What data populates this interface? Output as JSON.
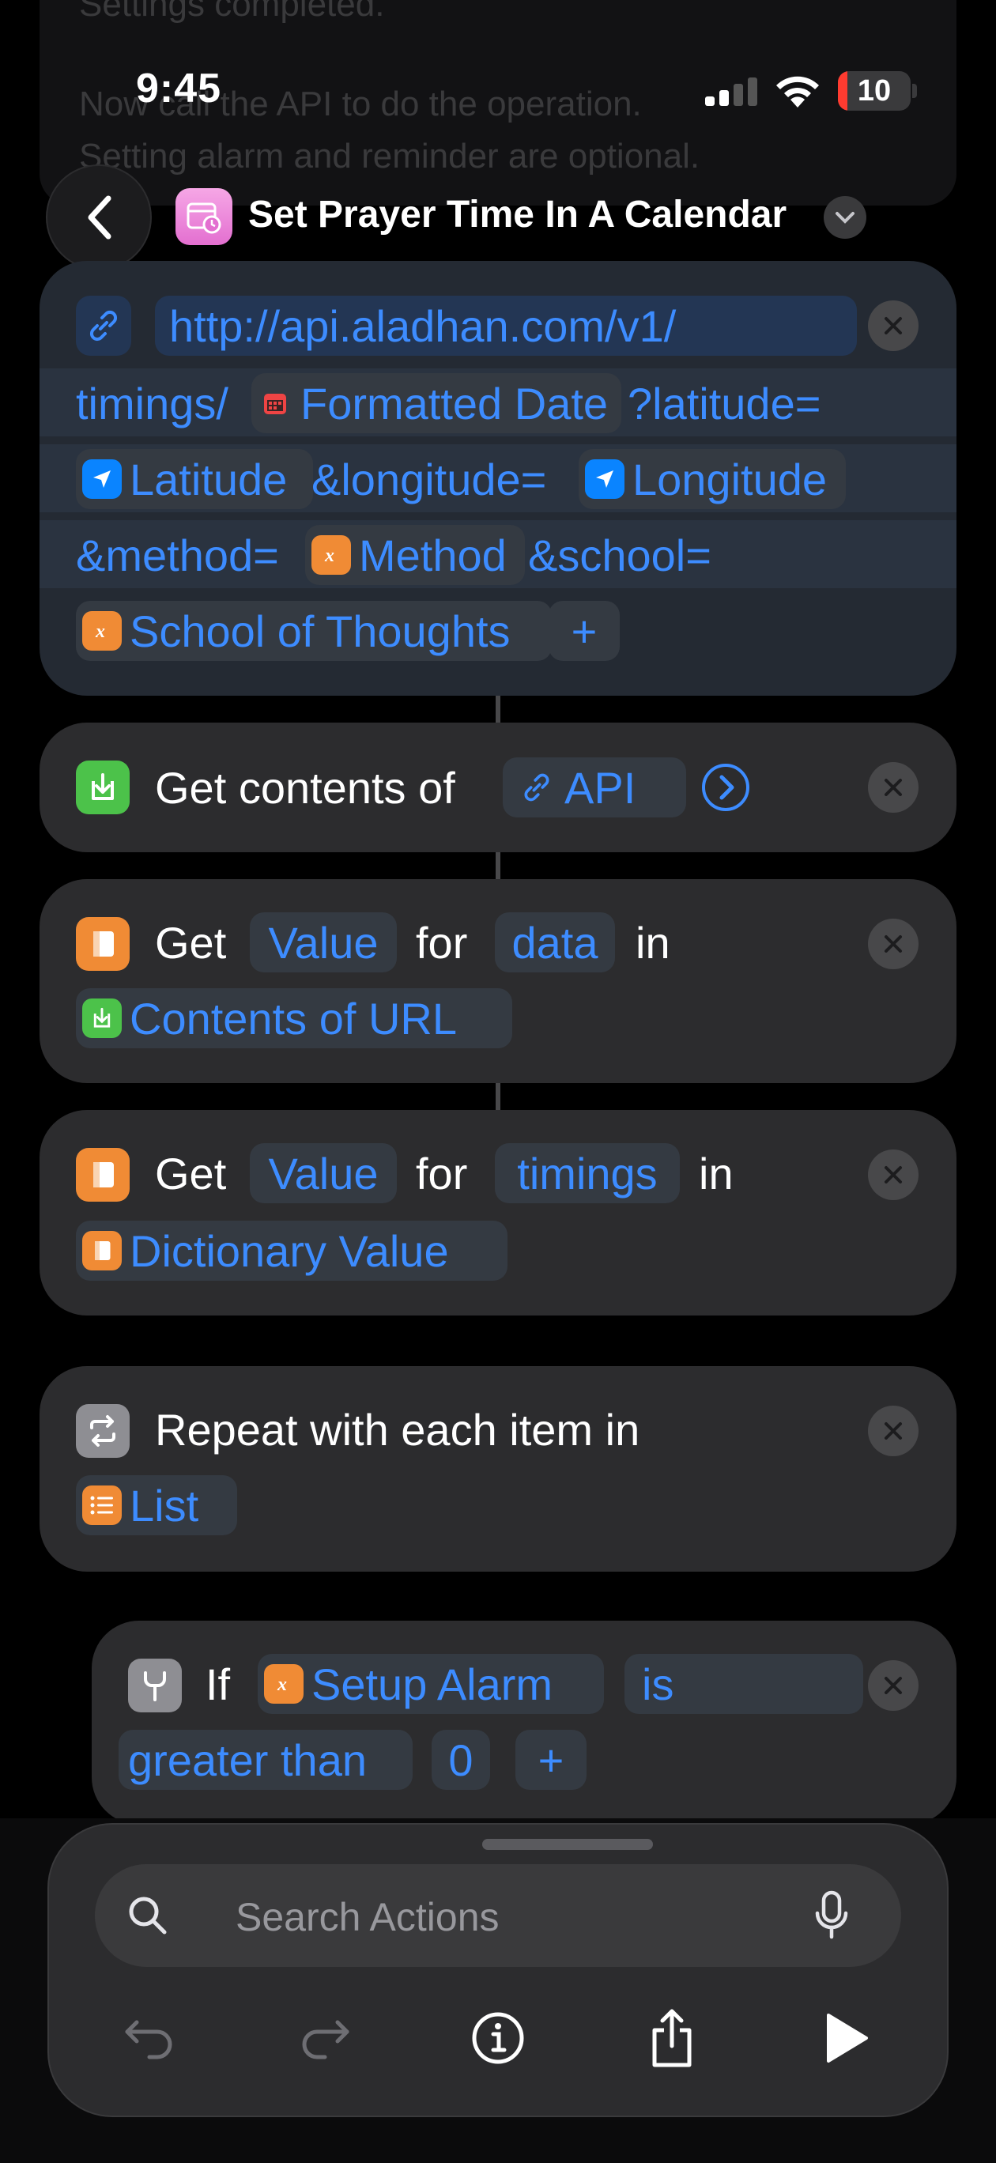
{
  "status_bar": {
    "time": "9:45",
    "battery": "10"
  },
  "background_ghost": {
    "line1": "Settings completed.",
    "line2": "Now call the API to do the operation.",
    "line3": "Setting alarm and reminder are optional."
  },
  "header": {
    "title": "Set Prayer Time In A Calendar",
    "icon": "calendar-clock-icon"
  },
  "url_action": {
    "line1": "http://api.aladhan.com/v1/",
    "line2_prefix": "timings/",
    "formatted_date": "Formatted Date",
    "latitude_param": "?latitude=",
    "latitude": "Latitude",
    "longitude_param": "&longitude=",
    "longitude": "Longitude",
    "method_param": "&method=",
    "method": "Method",
    "school_param": "&school=",
    "school": "School of Thoughts",
    "add": "+"
  },
  "get_contents": {
    "label": "Get contents of",
    "api": "API"
  },
  "get_value_1": {
    "get": "Get",
    "value": "Value",
    "for": "for",
    "key": "data",
    "in": "in",
    "source": "Contents of URL"
  },
  "get_value_2": {
    "get": "Get",
    "value": "Value",
    "for": "for",
    "key": "timings",
    "in": "in",
    "source": "Dictionary Value"
  },
  "repeat": {
    "label": "Repeat with each item in",
    "source": "List"
  },
  "if_action": {
    "if": "If",
    "variable": "Setup Alarm",
    "op1": "is",
    "op2": "greater than",
    "value": "0",
    "add": "+"
  },
  "bottom_panel": {
    "search_placeholder": "Search Actions"
  },
  "colors": {
    "accent": "#3d8cff",
    "card": "#2c2c2e",
    "orange": "#f08b35",
    "green": "#4cc24a"
  }
}
